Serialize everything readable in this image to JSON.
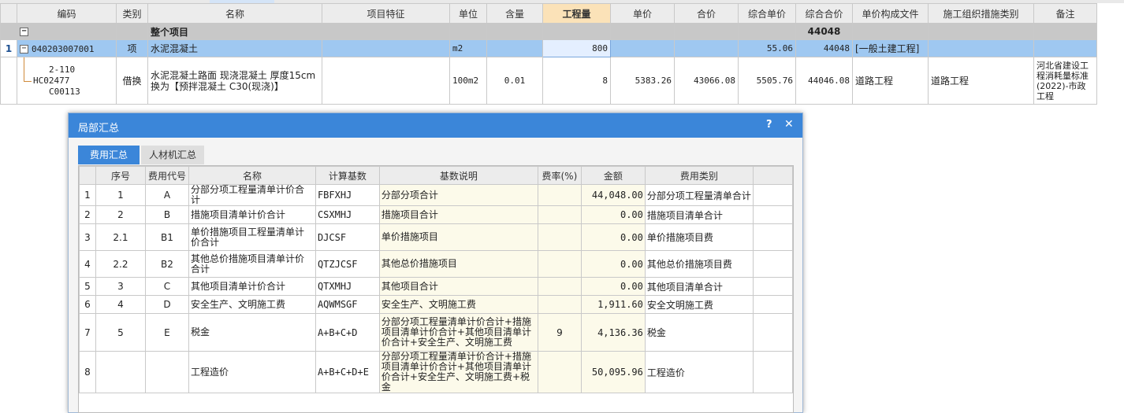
{
  "main_grid": {
    "columns": [
      "编码",
      "类别",
      "名称",
      "项目特征",
      "单位",
      "含量",
      "工程量",
      "单价",
      "合价",
      "综合单价",
      "综合合价",
      "单价构成文件",
      "施工组织措施类别",
      "备注"
    ],
    "group_row": {
      "toggle": "−",
      "name": "整个项目",
      "total": "44048"
    },
    "item_row": {
      "row_number": "1",
      "toggle": "−",
      "code": "040203007001",
      "category": "项",
      "name": "水泥混凝土",
      "unit": "m2",
      "quantity": "800",
      "comp_unit_price": "55.06",
      "comp_total": "44048",
      "price_file": "[一般土建工程]"
    },
    "detail_row": {
      "code_line1": "2-110 HC02477",
      "code_line2": "C00113",
      "category": "借换",
      "name_line1": "水泥混凝土路面 现浇混凝土 厚度15cm",
      "name_line2": "换为【预拌混凝土 C30(现浇)】",
      "unit": "100m2",
      "content": "0.01",
      "quantity": "8",
      "unit_price": "5383.26",
      "total_price": "43066.08",
      "comp_unit_price": "5505.76",
      "comp_total": "44046.08",
      "price_file": "道路工程",
      "measure_type": "道路工程",
      "remark": "河北省建设工程消耗量标准(2022)-市政工程"
    }
  },
  "dialog": {
    "title": "局部汇总",
    "help_icon": "?",
    "close_icon": "✕",
    "tabs": [
      "费用汇总",
      "人材机汇总"
    ],
    "columns": [
      "序号",
      "费用代号",
      "名称",
      "计算基数",
      "基数说明",
      "费率(%)",
      "金额",
      "费用类别"
    ],
    "rows": [
      {
        "rn": "1",
        "seq": "1",
        "code": "A",
        "name": "分部分项工程量清单计价合计",
        "base": "FBFXHJ",
        "base_desc": "分部分项合计",
        "rate": "",
        "amount": "44,048.00",
        "type": "分部分项工程量清单合计"
      },
      {
        "rn": "2",
        "seq": "2",
        "code": "B",
        "name": "措施项目清单计价合计",
        "base": "CSXMHJ",
        "base_desc": "措施项目合计",
        "rate": "",
        "amount": "0.00",
        "type": "措施项目清单合计"
      },
      {
        "rn": "3",
        "seq": "2.1",
        "code": "B1",
        "name": "单价措施项目工程量清单计价合计",
        "base": "DJCSF",
        "base_desc": "单价措施项目",
        "rate": "",
        "amount": "0.00",
        "type": "单价措施项目费"
      },
      {
        "rn": "4",
        "seq": "2.2",
        "code": "B2",
        "name": "其他总价措施项目清单计价合计",
        "base": "QTZJCSF",
        "base_desc": "其他总价措施项目",
        "rate": "",
        "amount": "0.00",
        "type": "其他总价措施项目费"
      },
      {
        "rn": "5",
        "seq": "3",
        "code": "C",
        "name": "其他项目清单计价合计",
        "base": "QTXMHJ",
        "base_desc": "其他项目合计",
        "rate": "",
        "amount": "0.00",
        "type": "其他项目清单合计"
      },
      {
        "rn": "6",
        "seq": "4",
        "code": "D",
        "name": "安全生产、文明施工费",
        "base": "AQWMSGF",
        "base_desc": "安全生产、文明施工费",
        "rate": "",
        "amount": "1,911.60",
        "type": "安全文明施工费"
      },
      {
        "rn": "7",
        "seq": "5",
        "code": "E",
        "name": "税金",
        "base": "A+B+C+D",
        "base_desc": "分部分项工程量清单计价合计+措施项目清单计价合计+其他项目清单计价合计+安全生产、文明施工费",
        "rate": "9",
        "amount": "4,136.36",
        "type": "税金"
      },
      {
        "rn": "8",
        "seq": "",
        "code": "",
        "name": "工程造价",
        "base": "A+B+C+D+E",
        "base_desc": "分部分项工程量清单计价合计+措施项目清单计价合计+其他项目清单计价合计+安全生产、文明施工费+税金",
        "rate": "",
        "amount": "50,095.96",
        "type": "工程造价"
      }
    ]
  }
}
